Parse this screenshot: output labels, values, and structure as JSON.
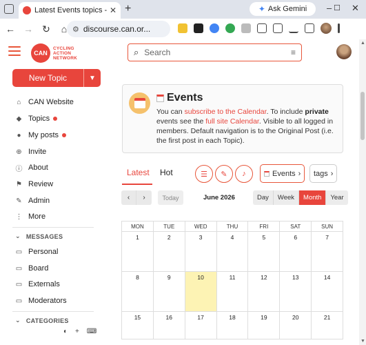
{
  "browser": {
    "tab_title": "Latest Events topics - CAN Disc",
    "url": "discourse.can.or...",
    "gemini_label": "Ask Gemini"
  },
  "site": {
    "logo_short": "CAN",
    "logo_text": [
      "CYCLING",
      "ACTION",
      "NETWORK"
    ],
    "search_placeholder": "Search"
  },
  "sidebar": {
    "new_topic_label": "New Topic",
    "items": [
      {
        "label": "CAN Website",
        "icon": "home-icon"
      },
      {
        "label": "Topics",
        "icon": "layers-icon",
        "unread": true
      },
      {
        "label": "My posts",
        "icon": "user-icon",
        "unread": true
      },
      {
        "label": "Invite",
        "icon": "user-plus-icon"
      },
      {
        "label": "About",
        "icon": "info-icon"
      },
      {
        "label": "Review",
        "icon": "flag-icon"
      },
      {
        "label": "Admin",
        "icon": "wrench-icon"
      },
      {
        "label": "More",
        "icon": "ellipsis-icon"
      }
    ],
    "messages_header": "MESSAGES",
    "messages": [
      {
        "label": "Personal",
        "icon": "inbox-icon"
      },
      {
        "label": "Board",
        "icon": "inbox-icon"
      },
      {
        "label": "Externals",
        "icon": "inbox-icon"
      },
      {
        "label": "Moderators",
        "icon": "inbox-icon"
      }
    ],
    "categories_header": "CATEGORIES"
  },
  "banner": {
    "title": "Events",
    "text_1": "You can ",
    "link_1": "subscribe to the Calendar",
    "text_2": ". To include ",
    "bold": "private",
    "text_3": " events see the ",
    "link_2": "full site Calendar",
    "text_4": ". Visible to all logged in members. Default navigation is to the Original Post (i.e. the first post in each Topic)."
  },
  "nav": {
    "tab_latest": "Latest",
    "tab_hot": "Hot",
    "events_label": "Events",
    "tags_label": "tags"
  },
  "calendar": {
    "today_label": "Today",
    "month_label": "June 2026",
    "views": [
      "Day",
      "Week",
      "Month",
      "Year"
    ],
    "active_view": "Month",
    "weekdays": [
      "MON",
      "TUE",
      "WED",
      "THU",
      "FRI",
      "SAT",
      "SUN"
    ],
    "weeks": [
      [
        "1",
        "2",
        "3",
        "4",
        "5",
        "6",
        "7"
      ],
      [
        "8",
        "9",
        "10",
        "11",
        "12",
        "13",
        "14"
      ],
      [
        "15",
        "16",
        "17",
        "18",
        "19",
        "20",
        "21"
      ]
    ],
    "today_date": "10"
  },
  "colors": {
    "accent": "#e8453c",
    "today_bg": "#fdf3b4"
  }
}
